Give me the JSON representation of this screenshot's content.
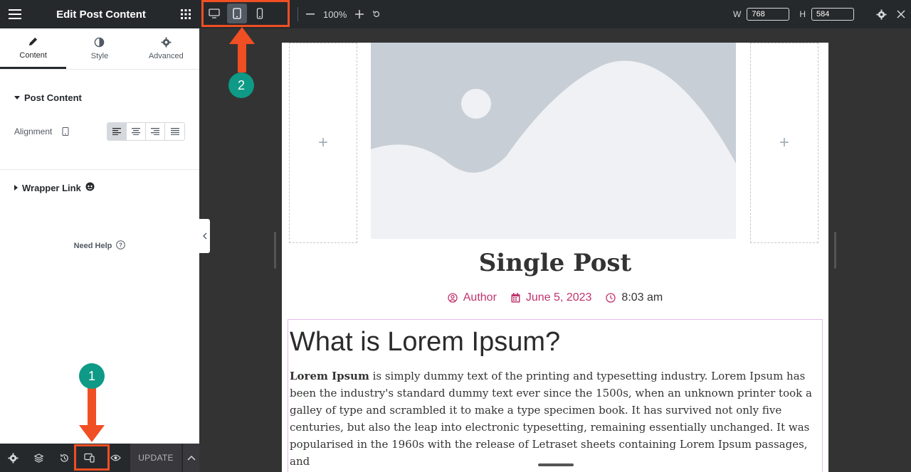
{
  "sidebar": {
    "title": "Edit Post Content",
    "tabs": [
      {
        "label": "Content",
        "icon": "pencil-icon"
      },
      {
        "label": "Style",
        "icon": "contrast-icon"
      },
      {
        "label": "Advanced",
        "icon": "gear-icon"
      }
    ],
    "section_post_content": "Post Content",
    "alignment_label": "Alignment",
    "alignment_options": [
      "left",
      "center",
      "right",
      "justify"
    ],
    "alignment_selected": "left",
    "section_wrapper_link": "Wrapper Link",
    "need_help": "Need Help",
    "footer": {
      "update_label": "UPDATE"
    }
  },
  "topbar": {
    "devices": [
      "desktop",
      "tablet",
      "mobile"
    ],
    "active_device": "tablet",
    "zoom": "100%",
    "width_label": "W",
    "width_value": "768",
    "height_label": "H",
    "height_value": "584"
  },
  "canvas": {
    "post_title": "Single Post",
    "meta": {
      "author": "Author",
      "date": "June 5, 2023",
      "time": "8:03 am"
    },
    "heading": "What is Lorem Ipsum?",
    "paragraph_bold": "Lorem Ipsum",
    "paragraph_rest": " is simply dummy text of the printing and typesetting industry. Lorem Ipsum has been the industry's standard dummy text ever since the 1500s, when an unknown printer took a galley of type and scrambled it to make a type specimen book. It has survived not only five centuries, but also the leap into electronic typesetting, remaining essentially unchanged. It was popularised in the 1960s with the release of Letraset sheets containing Lorem Ipsum passages, and",
    "add_column_symbol": "+"
  },
  "annotations": {
    "step1": "1",
    "step2": "2",
    "color": "#f04e23",
    "badge_color": "#0e9a87"
  }
}
